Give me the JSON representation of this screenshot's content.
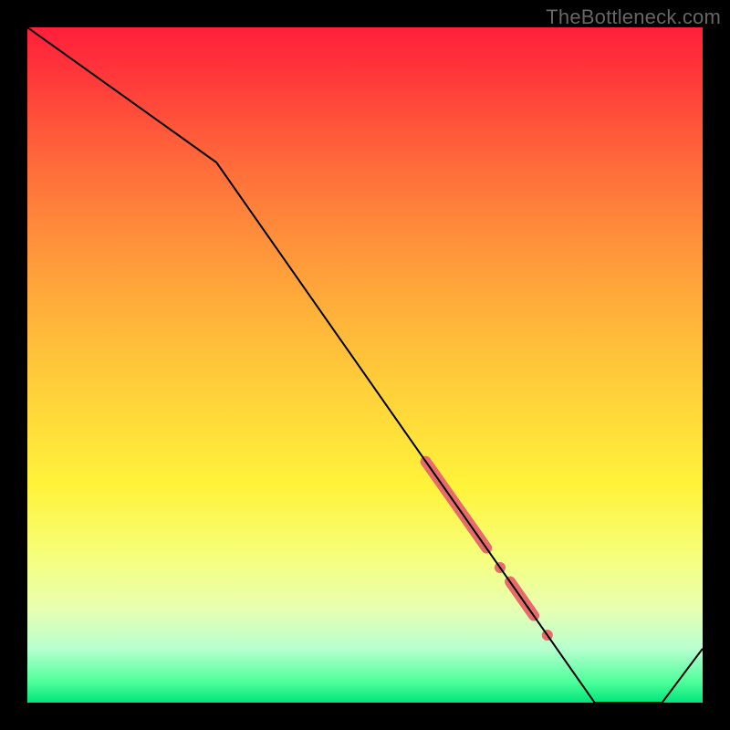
{
  "watermark": "TheBottleneck.com",
  "chart_data": {
    "type": "line",
    "title": "",
    "xlabel": "",
    "ylabel": "",
    "xlim": [
      0,
      100
    ],
    "ylim": [
      0,
      100
    ],
    "grid": false,
    "line": {
      "x": [
        0,
        28,
        84,
        94,
        100
      ],
      "y": [
        100,
        80,
        0,
        0,
        8
      ],
      "color": "#000000",
      "width": 2
    },
    "highlight_segments": [
      {
        "x1": 59.0,
        "y1": 35.7,
        "x2": 68.0,
        "y2": 22.9,
        "width": 12
      },
      {
        "x1": 71.5,
        "y1": 17.9,
        "x2": 75.0,
        "y2": 12.9,
        "width": 12
      }
    ],
    "highlight_points": [
      {
        "x": 70.0,
        "y": 20.0,
        "r": 6
      },
      {
        "x": 77.0,
        "y": 10.0,
        "r": 6
      }
    ],
    "highlight_color": "#e76b6b"
  }
}
